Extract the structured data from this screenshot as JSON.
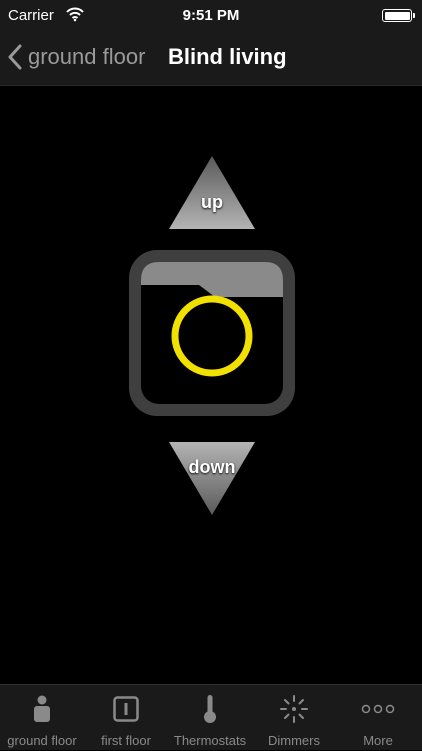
{
  "status_bar": {
    "carrier": "Carrier",
    "time": "9:51 PM"
  },
  "nav": {
    "back_label": "ground floor",
    "title": "Blind living"
  },
  "controls": {
    "up_label": "up",
    "down_label": "down"
  },
  "tabs": [
    {
      "label": "ground floor",
      "icon": "person-icon"
    },
    {
      "label": "first floor",
      "icon": "switch-icon"
    },
    {
      "label": "Thermostats",
      "icon": "thermometer-icon"
    },
    {
      "label": "Dimmers",
      "icon": "dimmer-icon"
    },
    {
      "label": "More",
      "icon": "more-icon"
    }
  ],
  "colors": {
    "accent": "#f2e000",
    "background": "#000000",
    "bar": "#1a1a1a",
    "inactive": "#8a8a8a"
  }
}
